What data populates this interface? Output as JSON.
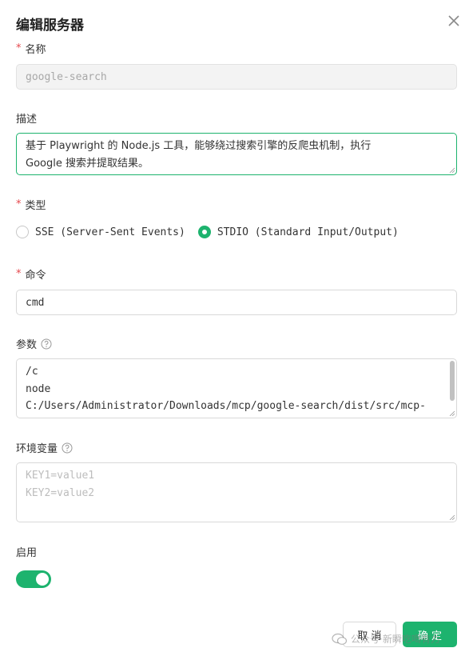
{
  "dialog": {
    "title": "编辑服务器"
  },
  "name_field": {
    "label": "名称",
    "value": "google-search"
  },
  "description": {
    "label": "描述",
    "line1": "基于 Playwright 的 Node.js 工具，能够绕过搜索引擎的反爬虫机制，执行",
    "line2": "Google 搜索并提取结果。"
  },
  "type": {
    "label": "类型",
    "options": [
      {
        "label": "SSE (Server-Sent Events)",
        "selected": false
      },
      {
        "label": "STDIO (Standard Input/Output)",
        "selected": true
      }
    ]
  },
  "command": {
    "label": "命令",
    "value": "cmd"
  },
  "args": {
    "label": "参数",
    "lines": [
      "/c",
      "node",
      "C:/Users/Administrator/Downloads/mcp/google-search/dist/src/mcp-"
    ]
  },
  "env": {
    "label": "环境变量",
    "placeholder_lines": [
      "KEY1=value1",
      "KEY2=value2"
    ]
  },
  "enabled": {
    "label": "启用",
    "on": true
  },
  "buttons": {
    "cancel": "取 消",
    "ok": "确 定"
  },
  "watermark": {
    "text": "公众号·新瞬吃喝有力"
  },
  "colors": {
    "accent": "#1db36e",
    "required": "#e5484d"
  }
}
